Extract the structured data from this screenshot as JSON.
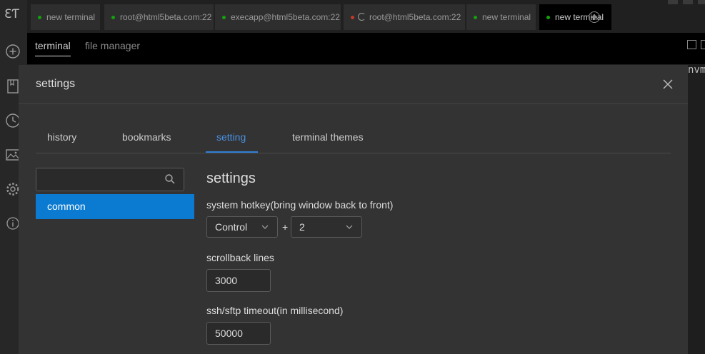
{
  "app": {
    "logo": "ƐƬ"
  },
  "sidebar": {
    "icons": [
      "plus-circle-icon",
      "bookmark-icon",
      "clock-icon",
      "image-icon",
      "gear-icon",
      "info-icon"
    ]
  },
  "tabs": [
    {
      "label": "new terminal",
      "status": "green"
    },
    {
      "label": "root@html5beta.com:22",
      "status": "green"
    },
    {
      "label": "execapp@html5beta.com:22",
      "status": "green"
    },
    {
      "label": "root@html5beta.com:22",
      "status": "red",
      "loading": true
    },
    {
      "label": "new terminal",
      "status": "green"
    },
    {
      "label": "new terminal",
      "status": "green",
      "active": true
    }
  ],
  "subtabs": {
    "terminal": "terminal",
    "file_manager": "file manager"
  },
  "terminal_output": "nvm",
  "modal": {
    "title": "settings",
    "tabs": [
      "history",
      "bookmarks",
      "setting",
      "terminal themes"
    ],
    "active_tab": "setting",
    "search": {
      "value": "",
      "placeholder": ""
    },
    "list": [
      "common"
    ],
    "heading": "settings",
    "hotkey": {
      "label": "system hotkey(bring window back to front)",
      "modifier": "Control",
      "plus": "+",
      "key": "2"
    },
    "scrollback": {
      "label": "scrollback lines",
      "value": "3000"
    },
    "timeout": {
      "label": "ssh/sftp timeout(in millisecond)",
      "value": "50000"
    }
  },
  "colors": {
    "accent": "#2f7fd8",
    "selected_item": "#0b7bd1",
    "status_green": "#13a10e",
    "status_red": "#c0392b"
  }
}
